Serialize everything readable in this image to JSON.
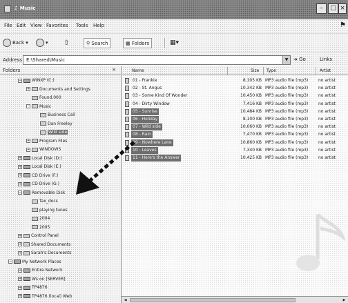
{
  "window": {
    "title": "♫ Music"
  },
  "menu": [
    "File",
    "Edit",
    "View",
    "Favorites",
    "Tools",
    "Help"
  ],
  "toolbar": {
    "back": "Back",
    "search": "Search",
    "folders": "Folders"
  },
  "address": {
    "label": "Address",
    "value": "E:\\Shared\\Music",
    "go": "Go",
    "links": "Links"
  },
  "folders": {
    "header": "Folders",
    "close": "×",
    "items": [
      {
        "label": "WINXP (C:)",
        "expand": "−",
        "icon": "drive"
      },
      {
        "label": "Documents and Settings",
        "expand": "+",
        "icon": "folder"
      },
      {
        "label": "Found.000",
        "expand": "",
        "icon": "folder"
      },
      {
        "label": "Music",
        "expand": "−",
        "icon": "folder"
      },
      {
        "label": "Business Call",
        "expand": "",
        "icon": "folder"
      },
      {
        "label": "Dan Freeley",
        "expand": "",
        "icon": "folder"
      },
      {
        "label": "Wild side",
        "expand": "",
        "icon": "folder",
        "selected": true
      },
      {
        "label": "Program Files",
        "expand": "+",
        "icon": "folder"
      },
      {
        "label": "WINDOWS",
        "expand": "+",
        "icon": "folder"
      },
      {
        "label": "Local Disk (D:)",
        "expand": "+",
        "icon": "drive"
      },
      {
        "label": "Local Disk (E:)",
        "expand": "+",
        "icon": "drive"
      },
      {
        "label": "CD Drive (F:)",
        "expand": "+",
        "icon": "drive"
      },
      {
        "label": "CD Drive (G:)",
        "expand": "+",
        "icon": "drive"
      },
      {
        "label": "Removable Disk",
        "expand": "−",
        "icon": "drive"
      },
      {
        "label": "Tax_docs",
        "expand": "",
        "icon": "folder"
      },
      {
        "label": "playing tunes",
        "expand": "",
        "icon": "folder"
      },
      {
        "label": "2004",
        "expand": "",
        "icon": "folder"
      },
      {
        "label": "2005",
        "expand": "",
        "icon": "folder"
      },
      {
        "label": "Control Panel",
        "expand": "+",
        "icon": "folder"
      },
      {
        "label": "Shared Documents",
        "expand": "+",
        "icon": "folder"
      },
      {
        "label": "Sarah's Documents",
        "expand": "+",
        "icon": "folder"
      },
      {
        "label": "My Network Places",
        "expand": "−",
        "icon": "drive"
      },
      {
        "label": "Entire Network",
        "expand": "+",
        "icon": "drive"
      },
      {
        "label": "Ws on [SERVER]",
        "expand": "+",
        "icon": "drive"
      },
      {
        "label": "TP4876",
        "expand": "+",
        "icon": "drive"
      },
      {
        "label": "TP4876 (local) Web",
        "expand": "+",
        "icon": "drive"
      }
    ]
  },
  "files": {
    "columns": {
      "name": "Name",
      "size": "Size",
      "type": "Type",
      "artist": "Artist"
    },
    "rows": [
      {
        "name": "01 - Frankie",
        "size": "8,105 KB",
        "type": "MP3 audio file (mp3)",
        "artist": "no artist",
        "selected": false
      },
      {
        "name": "02 - St. Angus",
        "size": "10,342 KB",
        "type": "MP3 audio file (mp3)",
        "artist": "no artist",
        "selected": false
      },
      {
        "name": "03 - Some Kind Of Wonder",
        "size": "10,450 KB",
        "type": "MP3 audio file (mp3)",
        "artist": "no artist",
        "selected": false
      },
      {
        "name": "04 - Dirty Window",
        "size": "7,416 KB",
        "type": "MP3 audio file (mp3)",
        "artist": "no artist",
        "selected": false
      },
      {
        "name": "05 - Sunrise",
        "size": "10,484 KB",
        "type": "MP3 audio file (mp3)",
        "artist": "no artist",
        "selected": true
      },
      {
        "name": "06 - Holiday",
        "size": "8,100 KB",
        "type": "MP3 audio file (mp3)",
        "artist": "no artist",
        "selected": true
      },
      {
        "name": "07 - Wild side",
        "size": "10,060 KB",
        "type": "MP3 audio file (mp3)",
        "artist": "no artist",
        "selected": true
      },
      {
        "name": "08 - Rain",
        "size": "7,470 KB",
        "type": "MP3 audio file (mp3)",
        "artist": "no artist",
        "selected": true
      },
      {
        "name": "09 - Nowhere Lane",
        "size": "10,860 KB",
        "type": "MP3 audio file (mp3)",
        "artist": "no artist",
        "selected": true
      },
      {
        "name": "10 - Leaves",
        "size": "7,340 KB",
        "type": "MP3 audio file (mp3)",
        "artist": "no artist",
        "selected": true
      },
      {
        "name": "11 - Here's the Answer",
        "size": "10,425 KB",
        "type": "MP3 audio file (mp3)",
        "artist": "no artist",
        "selected": true
      }
    ]
  }
}
